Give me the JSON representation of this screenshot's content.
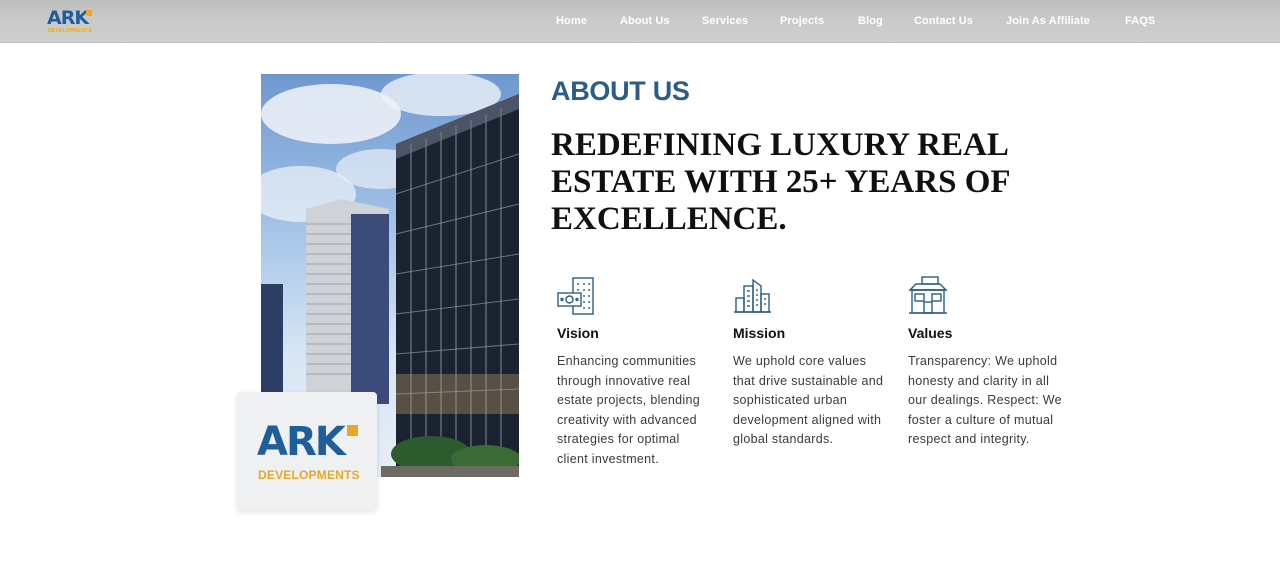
{
  "header": {
    "logo": {
      "mark": "ARK",
      "sub": "DEVELOPMENTS"
    },
    "nav": [
      "Home",
      "About Us",
      "Services",
      "Projects",
      "Blog",
      "Contact Us",
      "Join As Affiliate",
      "FAQS"
    ]
  },
  "about": {
    "kicker": "ABOUT US",
    "headline": "REDEFINING LUXURY REAL ESTATE WITH 25+ YEARS OF EXCELLENCE.",
    "image_logo": {
      "mark": "ARK",
      "sub": "DEVELOPMENTS"
    },
    "features": [
      {
        "icon": "building-money-icon",
        "title": "Vision",
        "text": "Enhancing communities through innovative real estate projects, blending creativity with advanced strategies for optimal client investment."
      },
      {
        "icon": "city-skyline-icon",
        "title": "Mission",
        "text": "We uphold core values that drive sustainable and sophisticated urban development aligned with global standards."
      },
      {
        "icon": "storefront-icon",
        "title": "Values",
        "text": "Transparency: We uphold honesty and clarity in all our dealings. Respect: We foster a culture of mutual respect and integrity."
      }
    ]
  },
  "colors": {
    "accent": "#2c5d84",
    "brand_blue": "#1f5f99",
    "brand_gold": "#e7a925"
  }
}
